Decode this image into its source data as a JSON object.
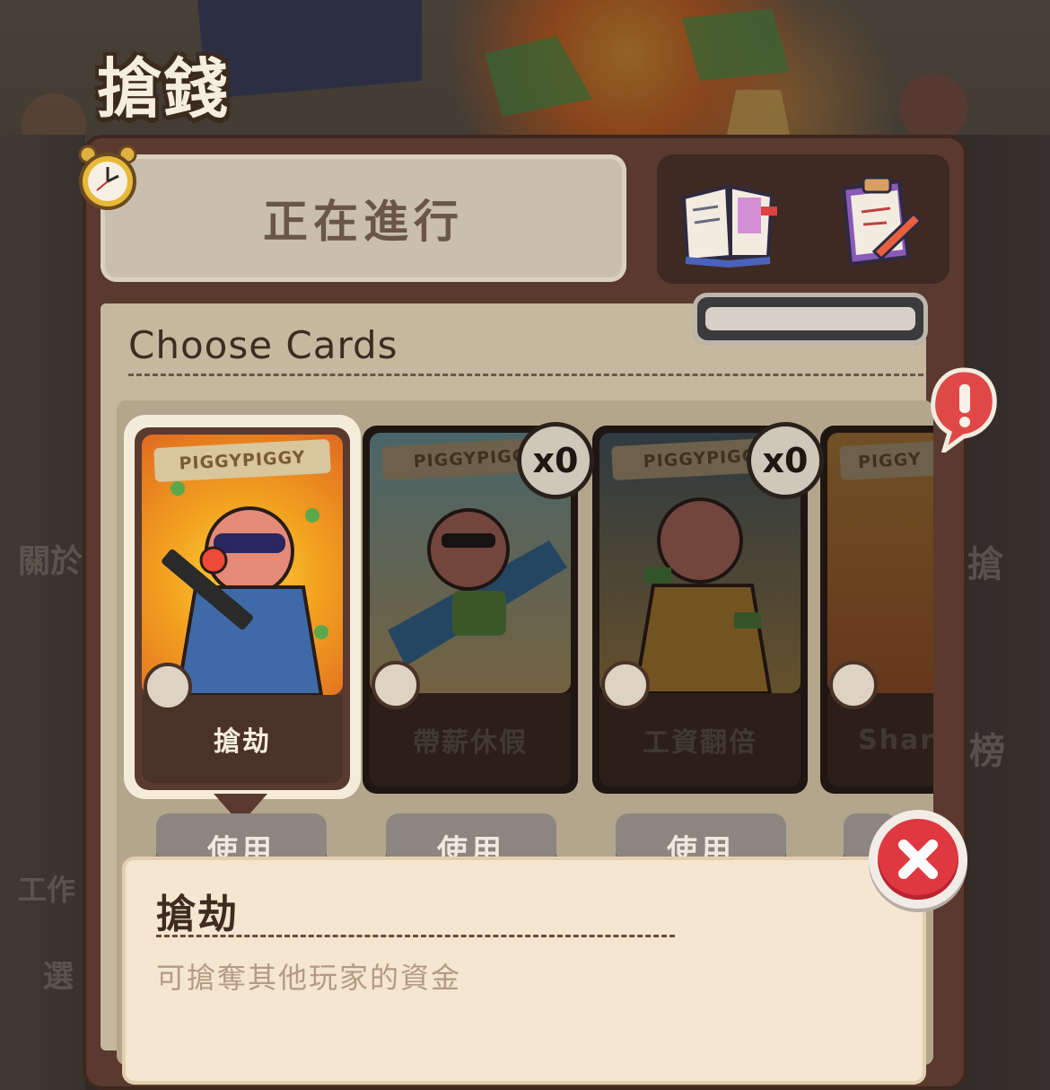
{
  "screen": {
    "title": "搶錢"
  },
  "status": {
    "label": "正在進行"
  },
  "background": {
    "left_labels": [
      "關於",
      "工作",
      "選"
    ],
    "right_labels": [
      "搶",
      "榜"
    ]
  },
  "choose_cards": {
    "heading": "Choose Cards"
  },
  "cards": [
    {
      "name": "搶劫",
      "banner": "PIGGYPIGGY",
      "count": "",
      "selected": true,
      "use_label": "使用"
    },
    {
      "name": "帶薪休假",
      "banner": "PIGGYPIGG",
      "count": "x0",
      "selected": false,
      "use_label": "使用"
    },
    {
      "name": "工資翻倍",
      "banner": "PIGGYPIGG",
      "count": "x0",
      "selected": false,
      "use_label": "使用"
    },
    {
      "name": "Shari",
      "banner": "PIGGY",
      "count": "",
      "selected": false,
      "use_label": ""
    }
  ],
  "detail": {
    "title": "搶劫",
    "description": "可搶奪其他玩家的資金"
  },
  "icons": {
    "alarm": "alarm-clock-icon",
    "notebook": "notebook-icon",
    "clipboard": "clipboard-pen-icon",
    "alert": "exclamation-alert-icon",
    "close": "close-icon"
  },
  "colors": {
    "panel": "#5a3a2e",
    "status_box": "#c9bfac",
    "close_red": "#e03840"
  }
}
